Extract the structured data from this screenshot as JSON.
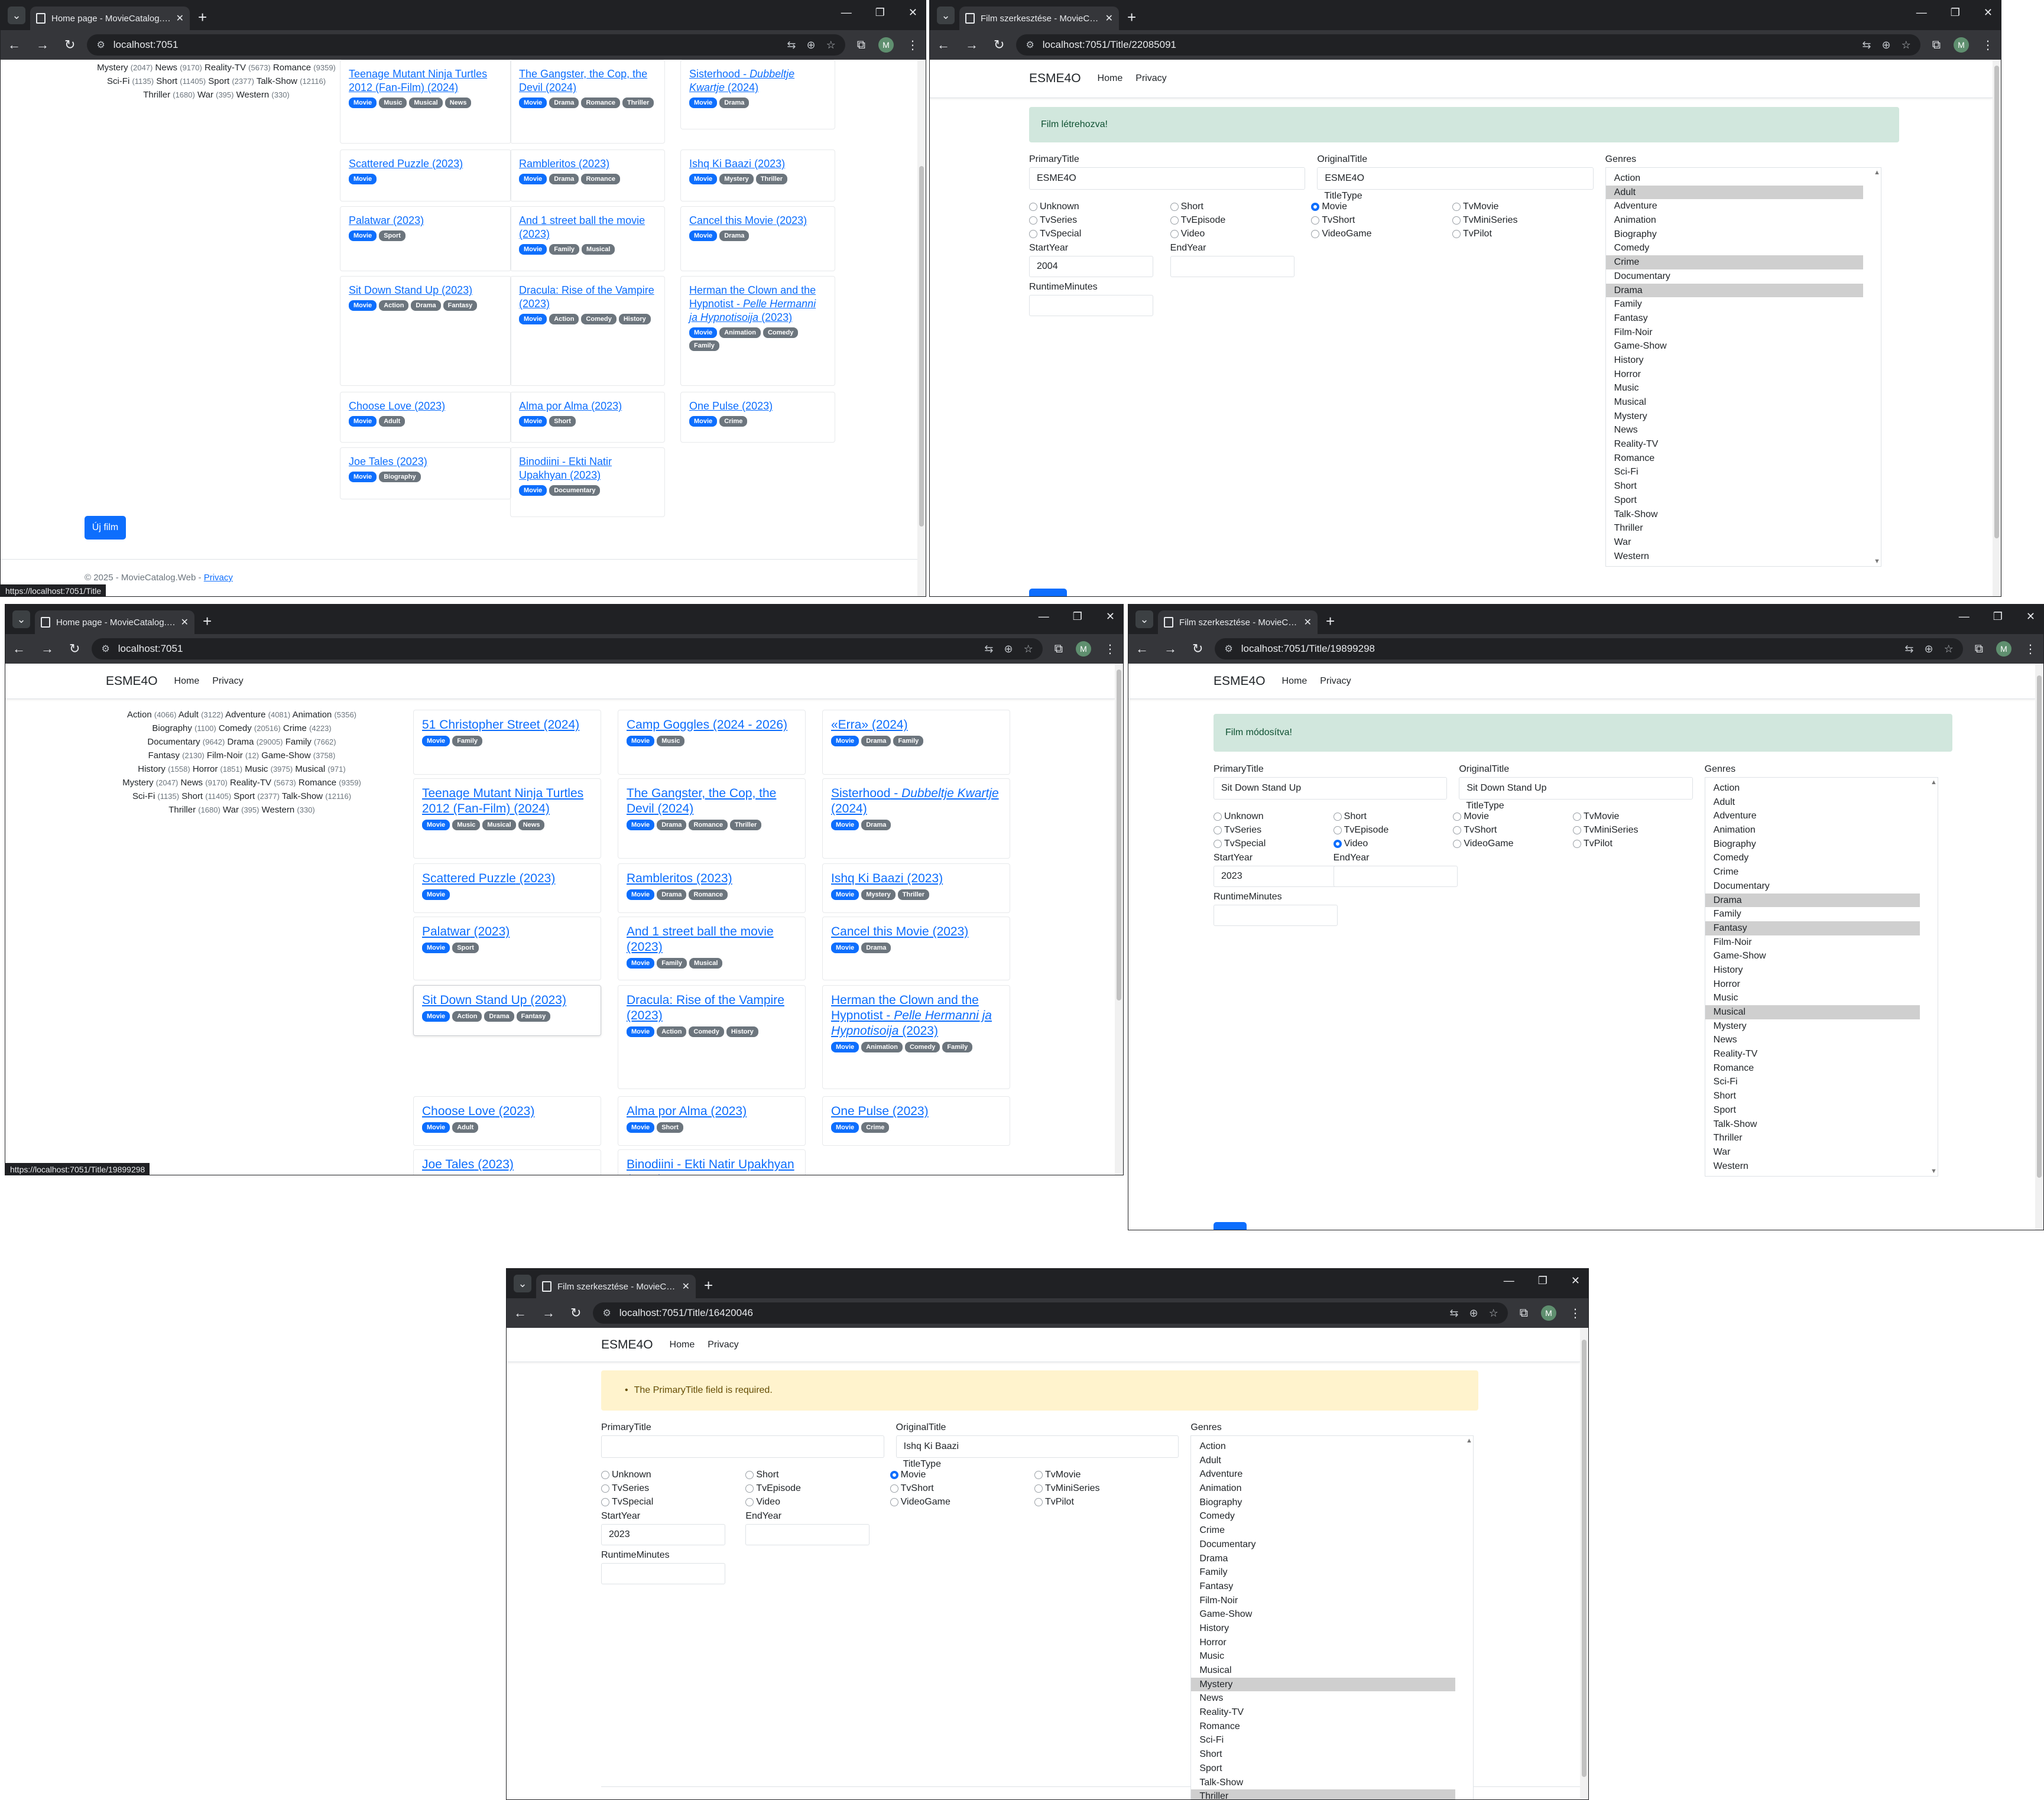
{
  "genres_list": [
    "Action",
    "Adult",
    "Adventure",
    "Animation",
    "Biography",
    "Comedy",
    "Crime",
    "Documentary",
    "Drama",
    "Family",
    "Fantasy",
    "Film-Noir",
    "Game-Show",
    "History",
    "Horror",
    "Music",
    "Musical",
    "Mystery",
    "News",
    "Reality-TV",
    "Romance",
    "Sci-Fi",
    "Short",
    "Sport",
    "Talk-Show",
    "Thriller",
    "War",
    "Western"
  ],
  "title_types": [
    "Unknown",
    "Short",
    "Movie",
    "TvMovie",
    "TvSeries",
    "TvEpisode",
    "TvShort",
    "TvMiniSeries",
    "TvSpecial",
    "Video",
    "VideoGame",
    "TvPilot"
  ],
  "form_labels": {
    "primary_title": "PrimaryTitle",
    "original_title": "OriginalTitle",
    "genres": "Genres",
    "title_type": "TitleType",
    "start_year": "StartYear",
    "end_year": "EndYear",
    "runtime": "RuntimeMinutes"
  },
  "site": {
    "brand": "ESME4O",
    "nav_home": "Home",
    "nav_privacy": "Privacy"
  },
  "window1": {
    "tab_title": "Home page - MovieCatalog.We",
    "url": "localhost:7051",
    "sidebar_genre_lines": [
      [
        [
          "Mystery",
          "(2047)"
        ],
        [
          "News",
          "(9170)"
        ],
        [
          "Reality-TV",
          "(5673)"
        ],
        [
          "Romance",
          "(9359)"
        ]
      ],
      [
        [
          "Sci-Fi",
          "(1135)"
        ],
        [
          "Short",
          "(11405)"
        ],
        [
          "Sport",
          "(2377)"
        ],
        [
          "Talk-Show",
          "(12116)"
        ]
      ],
      [
        [
          "Thriller",
          "(1680)"
        ],
        [
          "War",
          "(395)"
        ],
        [
          "Western",
          "(330)"
        ]
      ]
    ],
    "new_film_button": "Új film",
    "footer_text": "© 2025 - MovieCatalog.Web -",
    "footer_link": "Privacy",
    "status_url": "https://localhost:7051/Title"
  },
  "window2": {
    "tab_title": "Film szerkesztése - MovieCatal",
    "url": "localhost:7051/Title/22085091",
    "alert": "Film létrehozva!",
    "primary_title_value": "ESME4O",
    "original_title_value": "ESME4O",
    "start_year_value": "2004",
    "end_year_value": "",
    "runtime_value": "",
    "selected_type": "Movie",
    "selected_genres": [
      "Adult",
      "Crime",
      "Drama"
    ]
  },
  "window3": {
    "tab_title": "Home page - MovieCatalog.We",
    "url": "localhost:7051",
    "sidebar_genre_lines": [
      [
        [
          "Action",
          "(4066)"
        ],
        [
          "Adult",
          "(3122)"
        ],
        [
          "Adventure",
          "(4081)"
        ],
        [
          "Animation",
          "(5356)"
        ]
      ],
      [
        [
          "Biography",
          "(1100)"
        ],
        [
          "Comedy",
          "(20516)"
        ],
        [
          "Crime",
          "(4223)"
        ]
      ],
      [
        [
          "Documentary",
          "(9642)"
        ],
        [
          "Drama",
          "(29005)"
        ],
        [
          "Family",
          "(7662)"
        ]
      ],
      [
        [
          "Fantasy",
          "(2130)"
        ],
        [
          "Film-Noir",
          "(12)"
        ],
        [
          "Game-Show",
          "(3758)"
        ]
      ],
      [
        [
          "History",
          "(1558)"
        ],
        [
          "Horror",
          "(1851)"
        ],
        [
          "Music",
          "(3975)"
        ],
        [
          "Musical",
          "(971)"
        ]
      ],
      [
        [
          "Mystery",
          "(2047)"
        ],
        [
          "News",
          "(9170)"
        ],
        [
          "Reality-TV",
          "(5673)"
        ],
        [
          "Romance",
          "(9359)"
        ]
      ],
      [
        [
          "Sci-Fi",
          "(1135)"
        ],
        [
          "Short",
          "(11405)"
        ],
        [
          "Sport",
          "(2377)"
        ],
        [
          "Talk-Show",
          "(12116)"
        ]
      ],
      [
        [
          "Thriller",
          "(1680)"
        ],
        [
          "War",
          "(395)"
        ],
        [
          "Western",
          "(330)"
        ]
      ]
    ],
    "status_url": "https://localhost:7051/Title/19899298"
  },
  "window4": {
    "tab_title": "Film szerkesztése - MovieCatal",
    "url": "localhost:7051/Title/19899298",
    "alert": "Film módosítva!",
    "primary_title_value": "Sit Down Stand Up",
    "original_title_value": "Sit Down Stand Up",
    "start_year_value": "2023",
    "end_year_value": "",
    "runtime_value": "",
    "selected_type": "Video",
    "selected_genres": [
      "Drama",
      "Fantasy",
      "Musical"
    ]
  },
  "window5": {
    "tab_title": "Film szerkesztése - MovieCatal",
    "url": "localhost:7051/Title/16420046",
    "alert": "The PrimaryTitle field is required.",
    "primary_title_value": "",
    "original_title_value": "Ishq Ki Baazi",
    "start_year_value": "2023",
    "end_year_value": "",
    "runtime_value": "",
    "selected_type": "Movie",
    "selected_genres": [
      "Mystery",
      "Thriller"
    ]
  },
  "movies": {
    "m51": {
      "title": "51 Christopher Street",
      "year": "(2024)",
      "genres": [
        "Movie",
        "Family"
      ]
    },
    "camp": {
      "title": "Camp Goggles",
      "year": "(2024 - 2026)",
      "genres": [
        "Movie",
        "Music"
      ]
    },
    "erra": {
      "title": "«Erra»",
      "year": "(2024)",
      "genres": [
        "Movie",
        "Drama",
        "Family"
      ]
    },
    "tmnt": {
      "title": "Teenage Mutant Ninja Turtles 2012 (Fan-Film)",
      "year": "(2024)",
      "genres": [
        "Movie",
        "Music",
        "Musical",
        "News"
      ]
    },
    "gangster": {
      "title": "The Gangster, the Cop, the Devil",
      "year": "(2024)",
      "genres": [
        "Movie",
        "Drama",
        "Romance",
        "Thriller"
      ]
    },
    "sisterhood": {
      "title": "Sisterhood",
      "alt": "Dubbeltje Kwartje",
      "year": "(2024)",
      "genres": [
        "Movie",
        "Drama"
      ]
    },
    "scattered": {
      "title": "Scattered Puzzle",
      "year": "(2023)",
      "genres": [
        "Movie"
      ]
    },
    "rambleritos": {
      "title": "Rambleritos",
      "year": "(2023)",
      "genres": [
        "Movie",
        "Drama",
        "Romance"
      ]
    },
    "ishq": {
      "title": "Ishq Ki Baazi",
      "year": "(2023)",
      "genres": [
        "Movie",
        "Mystery",
        "Thriller"
      ]
    },
    "palatwar": {
      "title": "Palatwar",
      "year": "(2023)",
      "genres": [
        "Movie",
        "Sport"
      ]
    },
    "street": {
      "title": "And 1 street ball the movie",
      "year": "(2023)",
      "genres": [
        "Movie",
        "Family",
        "Musical"
      ]
    },
    "cancel": {
      "title": "Cancel this Movie",
      "year": "(2023)",
      "genres": [
        "Movie",
        "Drama"
      ]
    },
    "sitdown": {
      "title": "Sit Down Stand Up",
      "year": "(2023)",
      "genres": [
        "Movie",
        "Action",
        "Drama",
        "Fantasy"
      ]
    },
    "dracula": {
      "title": "Dracula: Rise of the Vampire",
      "year": "(2023)",
      "genres": [
        "Movie",
        "Action",
        "Comedy",
        "History"
      ]
    },
    "herman": {
      "title": "Herman the Clown and the Hypnotist",
      "alt": "Pelle Hermanni ja Hypnotisoija",
      "year": "(2023)",
      "genres": [
        "Movie",
        "Animation",
        "Comedy",
        "Family"
      ]
    },
    "choose": {
      "title": "Choose Love",
      "year": "(2023)",
      "genres": [
        "Movie",
        "Adult"
      ]
    },
    "alma": {
      "title": "Alma por Alma",
      "year": "(2023)",
      "genres": [
        "Movie",
        "Short"
      ]
    },
    "pulse": {
      "title": "One Pulse",
      "year": "(2023)",
      "genres": [
        "Movie",
        "Crime"
      ]
    },
    "joe": {
      "title": "Joe Tales",
      "year": "(2023)",
      "genres": [
        "Movie",
        "Biography"
      ]
    },
    "binodiini": {
      "title": "Binodiini - Ekti Natir Upakhyan",
      "year": "(2023)",
      "genres": [
        "Movie",
        "Documentary"
      ]
    }
  }
}
